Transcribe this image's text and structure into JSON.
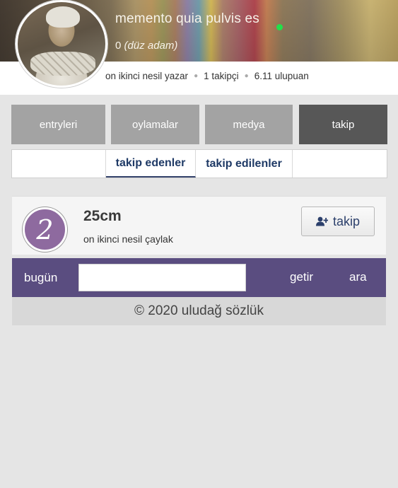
{
  "profile": {
    "nick": "memento quia pulvis es",
    "score": "0",
    "rank_title": "(düz adam)",
    "generation": "on ikinci nesil yazar",
    "followers": "1 takipçi",
    "points": "6.11 ulupuan",
    "online_color": "#22e04a"
  },
  "tabs": [
    {
      "label": "entryleri"
    },
    {
      "label": "oylamalar"
    },
    {
      "label": "medya"
    },
    {
      "label": "takip",
      "active": true
    }
  ],
  "subtabs": [
    {
      "label": ""
    },
    {
      "label": "takip edenler",
      "active": true
    },
    {
      "label": "takip edilenler"
    },
    {
      "label": ""
    }
  ],
  "follower": {
    "badge": "2",
    "badge_color": "#8e6a9f",
    "name": "25cm",
    "rank": "on ikinci nesil çaylak",
    "follow_label": "takip",
    "follow_icon": "user-plus-icon"
  },
  "footer": {
    "today_label": "bugün",
    "search_value": "",
    "get_label": "getir",
    "search_label": "ara",
    "bar_color": "#5a4d80",
    "copyright": "© 2020 uludağ sözlük"
  }
}
